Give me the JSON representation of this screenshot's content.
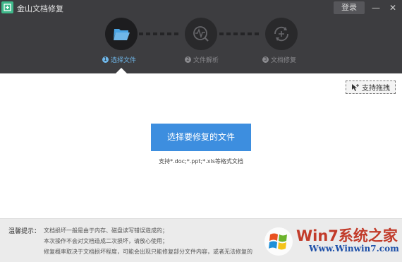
{
  "window": {
    "title": "金山文档修复",
    "login_label": "登录",
    "minimize_symbol": "—",
    "close_symbol": "✕"
  },
  "steps": [
    {
      "number": "1",
      "label": "选择文件",
      "icon": "folder-open-icon",
      "state": "active"
    },
    {
      "number": "2",
      "label": "文件解析",
      "icon": "analyze-icon",
      "state": "inactive"
    },
    {
      "number": "3",
      "label": "文档修复",
      "icon": "repair-icon",
      "state": "inactive"
    }
  ],
  "main": {
    "drag_label": "支持拖拽",
    "select_button": "选择要修复的文件",
    "support_formats": "支持*.doc;*.ppt;*.xls等格式文档"
  },
  "tips": {
    "label": "温馨提示：",
    "lines": [
      "文档损坏一般是由于内存、磁盘读写错误造成的；",
      "本次操作不会对文档造成二次损坏，请放心使用；",
      "修复概率取决于文档损坏程度，可能会出现只能修复部分文件内容，或者无法修复的"
    ]
  },
  "watermark": {
    "title": "Win7系统之家",
    "url": "Www.Winwin7.com"
  },
  "colors": {
    "header": "#3d3d40",
    "accent": "#3d8edf",
    "step_active_text": "#6fb6e8",
    "app_icon": "#3fb88a"
  }
}
